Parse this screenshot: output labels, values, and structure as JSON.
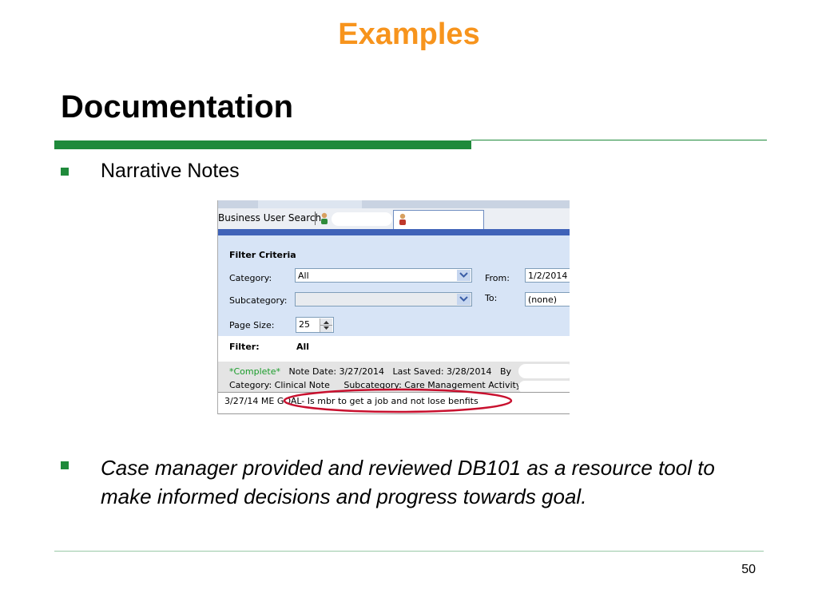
{
  "slide": {
    "title": "Examples",
    "heading": "Documentation",
    "bullets": [
      "Narrative Notes",
      "Case manager provided and reviewed DB101 as a resource tool to make informed decisions and progress towards goal."
    ],
    "page_number": "50"
  },
  "screenshot": {
    "tabs": {
      "first_label": "Business User Search"
    },
    "filter_panel": {
      "title": "Filter Criteria",
      "category_label": "Category:",
      "category_value": "All",
      "subcategory_label": "Subcategory:",
      "subcategory_value": "",
      "page_size_label": "Page Size:",
      "page_size_value": "25",
      "from_label": "From:",
      "from_value": "1/2/2014",
      "to_label": "To:",
      "to_value": "(none)"
    },
    "filter_summary": {
      "label": "Filter:",
      "value": "All"
    },
    "note": {
      "status": "*Complete*",
      "date": "Note Date: 3/27/2014",
      "last_saved": "Last Saved: 3/28/2014",
      "by": "By",
      "category": "Category: Clinical Note",
      "subcategory": "Subcategory: Care Management Activity",
      "text": "3/27/14 ME GOAL- Is mbr to get a job and not lose benfits"
    }
  },
  "colors": {
    "title_orange": "#f7941d",
    "accent_green": "#1f8a3b",
    "annotation_red": "#c8102e",
    "status_green": "#1a9c2a"
  }
}
